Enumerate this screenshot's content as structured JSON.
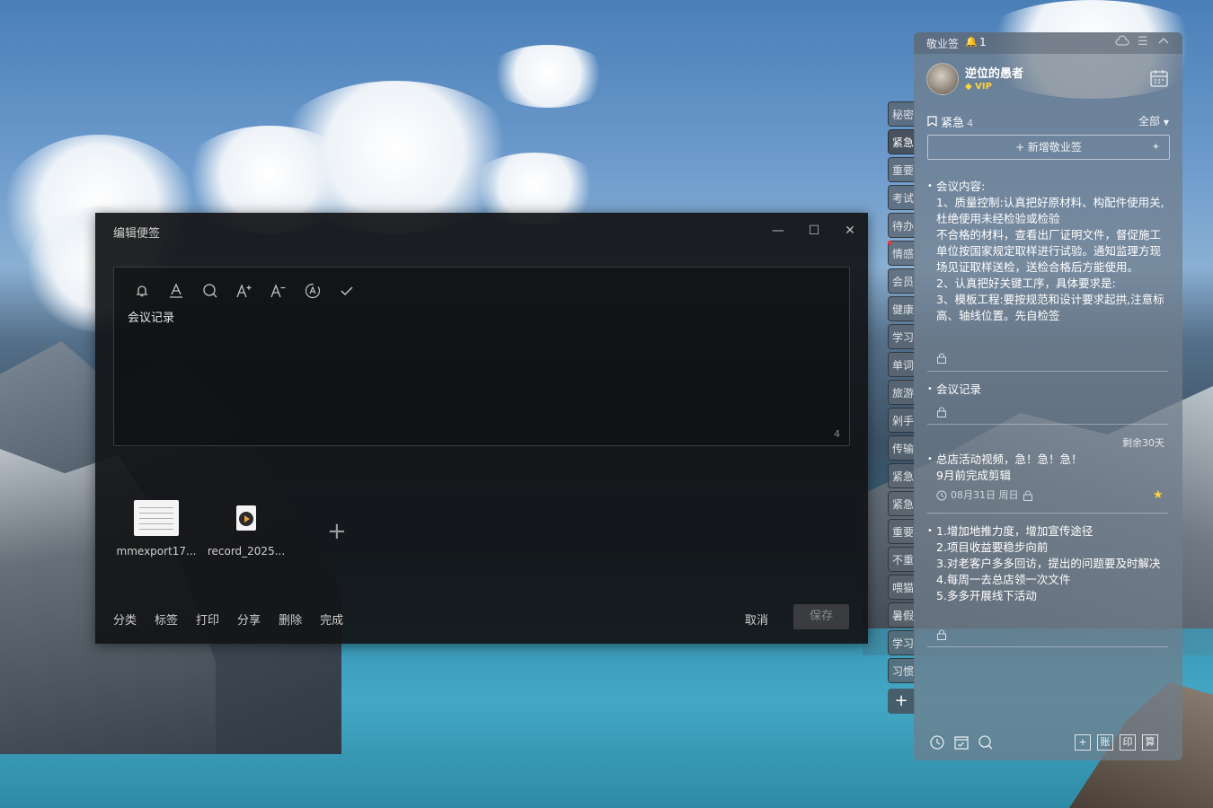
{
  "edit_window": {
    "title": "编辑便签",
    "content": "会议记录",
    "char_count": "4",
    "attachments": [
      {
        "name": "mmexport17...",
        "type": "image"
      },
      {
        "name": "record_2025...",
        "type": "audio"
      }
    ],
    "add_attachment": "+",
    "actions": [
      "分类",
      "标签",
      "打印",
      "分享",
      "删除",
      "完成"
    ],
    "cancel_label": "取消",
    "save_label": "保存"
  },
  "side_tabs": [
    "秘密",
    "紧急",
    "重要",
    "考试",
    "待办",
    "情感",
    "会员",
    "健康",
    "学习",
    "单词",
    "旅游",
    "剁手",
    "传输",
    "紧急",
    "紧急",
    "重要",
    "不重",
    "喂猫",
    "暑假",
    "学习",
    "习惯"
  ],
  "side_add": "+",
  "panel": {
    "title": "敬业签",
    "reminder_count": "1",
    "username": "逆位的愚者",
    "vip": "VIP",
    "category": "紧急",
    "category_count": "4",
    "filter": "全部",
    "new_note": "+ 新增敬业签",
    "remaining": "剩余30天",
    "notes": [
      {
        "text": "会议内容:\n1、质量控制:认真把好原材料、构配件使用关,杜绝使用未经检验或检验\n不合格的材料，查看出厂证明文件，督促施工单位按国家规定取样进行试验。通知监理方现场见证取样送检，送检合格后方能使用。\n2、认真把好关键工序，具体要求是:\n3、模板工程:要按规范和设计要求起拱,注意标高、轴线位置。先自检签"
      },
      {
        "text": "会议记录"
      },
      {
        "text": "总店活动视频，急！急！急！\n9月前完成剪辑",
        "date": "08月31日 周日"
      },
      {
        "text": "1.增加地推力度，增加宣传途径\n2.项目收益要稳步向前\n3.对老客户多多回访，提出的问题要及时解决\n4.每周一去总店领一次文件\n5.多多开展线下活动"
      }
    ],
    "bottom_buttons": [
      "账",
      "印",
      "算"
    ]
  },
  "colors": {
    "panel_bg": "#707d8a",
    "window_bg": "#121316",
    "vip": "#ffd23a",
    "alert": "#e03b3b"
  }
}
